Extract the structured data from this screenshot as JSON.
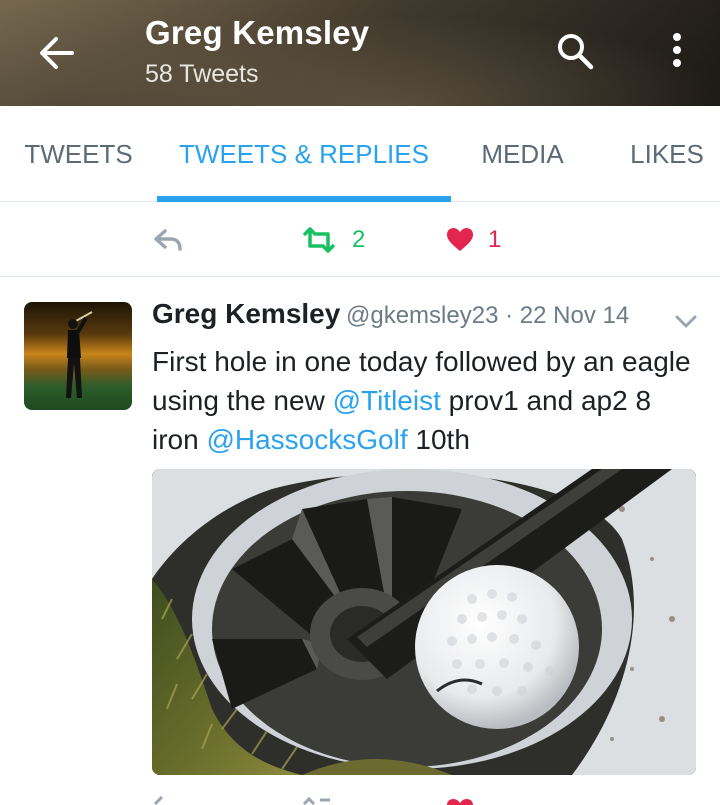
{
  "header": {
    "title": "Greg Kemsley",
    "subtitle": "58 Tweets",
    "back_icon": "arrow-left-icon",
    "search_icon": "search-icon",
    "more_icon": "more-vertical-icon"
  },
  "tabs": [
    {
      "label": "TWEETS",
      "active": false
    },
    {
      "label": "TWEETS & REPLIES",
      "active": true
    },
    {
      "label": "MEDIA",
      "active": false
    },
    {
      "label": "LIKES",
      "active": false
    }
  ],
  "previous_tweet_actions": {
    "reply_icon": "reply-icon",
    "retweet_count": "2",
    "like_count": "1"
  },
  "tweet": {
    "author_name": "Greg Kemsley",
    "handle": "@gkemsley23",
    "separator": "·",
    "date": "22 Nov 14",
    "text_part1": "First hole in one today followed by an eagle using the new ",
    "mention1": "@Titleist",
    "text_part2": " prov1 and ap2 8 iron ",
    "mention2": "@HassocksGolf",
    "text_part3": " 10th",
    "media_description_icon": "photo-golf-ball-in-cup"
  },
  "colors": {
    "accent": "#2aa3ef",
    "retweet": "#19bf63",
    "like": "#e2264d",
    "muted": "#6d7b87",
    "text": "#1d2125"
  }
}
